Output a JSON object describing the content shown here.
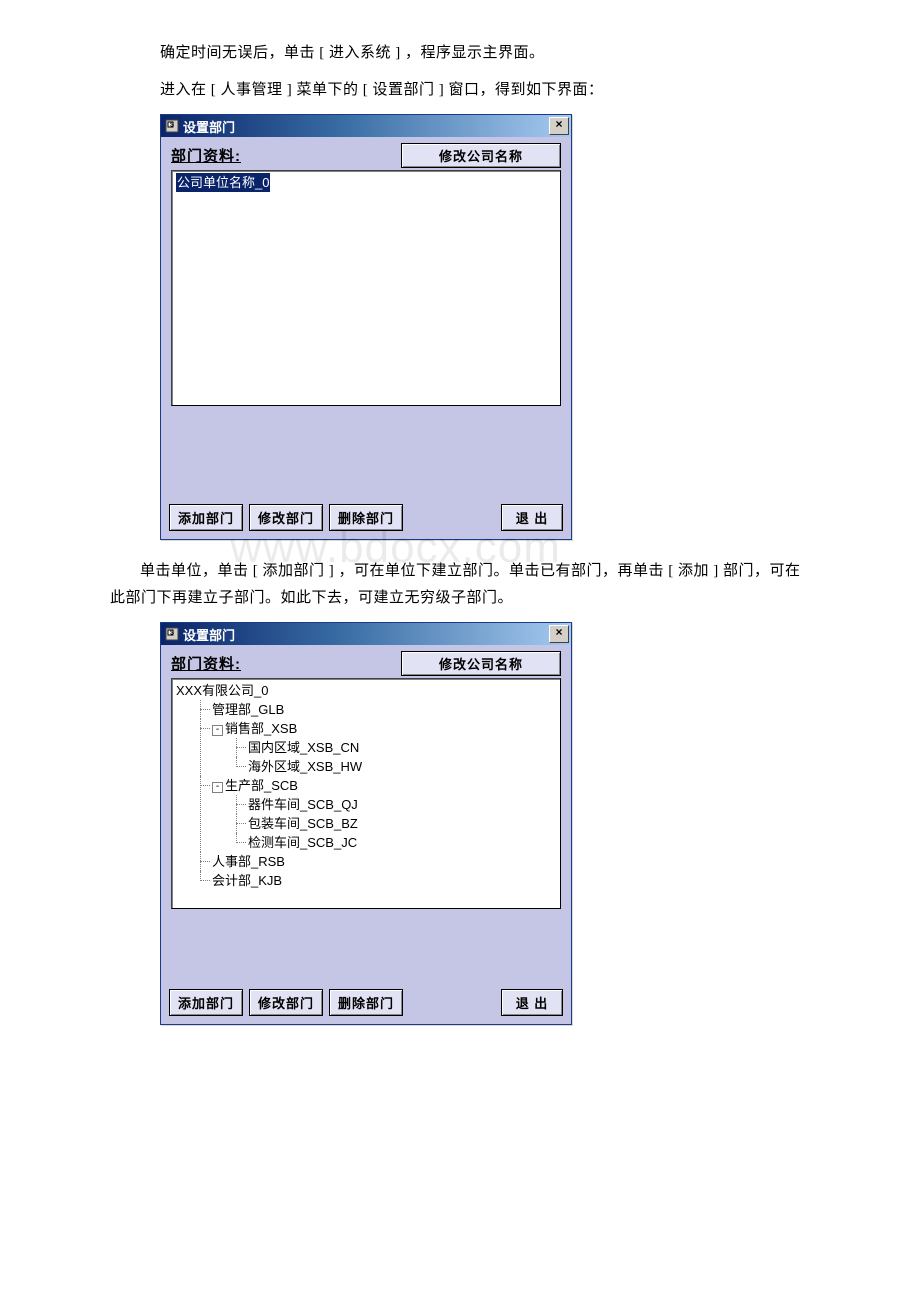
{
  "doc": {
    "p1": "确定时间无误后，单击 [ 进入系统 ] ，程序显示主界面。",
    "p2": "进入在 [ 人事管理 ] 菜单下的 [ 设置部门 ] 窗口，得到如下界面：",
    "p3": "单击单位，单击 [ 添加部门 ] ，可在单位下建立部门。单击已有部门，再单击 [ 添加 ] 部门，可在此部门下再建立子部门。如此下去，可建立无穷级子部门。",
    "watermark": "www.bdocx.com"
  },
  "dialog": {
    "title": "设置部门",
    "close": "×",
    "section_label": "部门资料:",
    "modify_company": "修改公司名称",
    "buttons": {
      "add": "添加部门",
      "modify": "修改部门",
      "delete": "删除部门",
      "exit": "退 出"
    }
  },
  "tree1": {
    "root": "公司单位名称_0"
  },
  "tree2": {
    "root": "XXX有限公司_0",
    "items": {
      "glb": "管理部_GLB",
      "xsb": "销售部_XSB",
      "xsb_cn": "国内区域_XSB_CN",
      "xsb_hw": "海外区域_XSB_HW",
      "scb": "生产部_SCB",
      "scb_qj": "器件车间_SCB_QJ",
      "scb_bz": "包装车间_SCB_BZ",
      "scb_jc": "检测车间_SCB_JC",
      "rsb": "人事部_RSB",
      "kjb": "会计部_KJB"
    },
    "expander": "-"
  }
}
